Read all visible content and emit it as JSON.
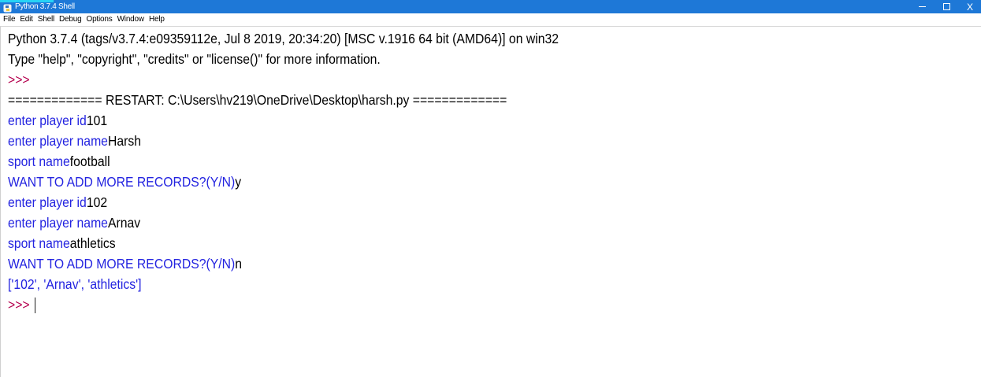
{
  "window": {
    "title": "Python 3.7.4 Shell",
    "minimize_glyph": "",
    "maximize_glyph": "",
    "close_glyph": "X"
  },
  "menu": {
    "items": [
      "File",
      "Edit",
      "Shell",
      "Debug",
      "Options",
      "Window",
      "Help"
    ]
  },
  "shell": {
    "lines": [
      {
        "parts": [
          {
            "text": "Python 3.7.4 (tags/v3.7.4:e09359112e, Jul  8 2019, 20:34:20) [MSC v.1916 64 bit (AMD64)] on win32",
            "style": "black"
          }
        ]
      },
      {
        "parts": [
          {
            "text": "Type \"help\", \"copyright\", \"credits\" or \"license()\" for more information.",
            "style": "black"
          }
        ]
      },
      {
        "parts": [
          {
            "text": ">>>",
            "style": "prompt"
          }
        ]
      },
      {
        "parts": [
          {
            "text": "============= RESTART: C:\\Users\\hv219\\OneDrive\\Desktop\\harsh.py =============",
            "style": "black"
          }
        ]
      },
      {
        "parts": [
          {
            "text": "enter player id",
            "style": "blue"
          },
          {
            "text": "101",
            "style": "black"
          }
        ]
      },
      {
        "parts": [
          {
            "text": "enter player name",
            "style": "blue"
          },
          {
            "text": "Harsh",
            "style": "black"
          }
        ]
      },
      {
        "parts": [
          {
            "text": "sport name",
            "style": "blue"
          },
          {
            "text": "football",
            "style": "black"
          }
        ]
      },
      {
        "parts": [
          {
            "text": "WANT TO ADD MORE RECORDS?(Y/N)",
            "style": "blue"
          },
          {
            "text": "y",
            "style": "black"
          }
        ]
      },
      {
        "parts": [
          {
            "text": "enter player id",
            "style": "blue"
          },
          {
            "text": "102",
            "style": "black"
          }
        ]
      },
      {
        "parts": [
          {
            "text": "enter player name",
            "style": "blue"
          },
          {
            "text": "Arnav",
            "style": "black"
          }
        ]
      },
      {
        "parts": [
          {
            "text": "sport name",
            "style": "blue"
          },
          {
            "text": "athletics",
            "style": "black"
          }
        ]
      },
      {
        "parts": [
          {
            "text": "WANT TO ADD MORE RECORDS?(Y/N)",
            "style": "blue"
          },
          {
            "text": "n",
            "style": "black"
          }
        ]
      },
      {
        "parts": [
          {
            "text": "['102', 'Arnav', 'athletics']",
            "style": "blue"
          }
        ]
      },
      {
        "parts": [
          {
            "text": ">>>",
            "style": "prompt"
          }
        ],
        "cursor": true
      }
    ]
  },
  "colors": {
    "titlebar": "#1e78d7",
    "prompt": "#b5004e",
    "output_blue": "#2323e0",
    "text": "#000000"
  }
}
